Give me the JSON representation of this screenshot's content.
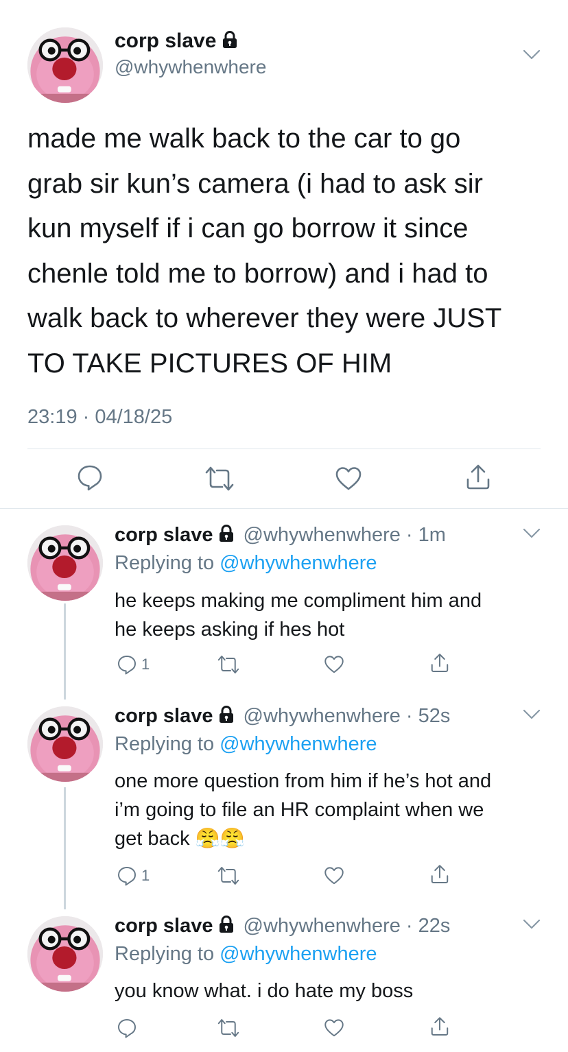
{
  "main": {
    "display_name": "corp slave",
    "handle": "@whywhenwhere",
    "text": "made me walk back to the car to go grab sir kun’s camera (i had to ask sir kun myself if i can go borrow it since chenle told me to borrow) and i had to walk back to wherever they were JUST TO TAKE PICTURES OF HIM",
    "lines": [
      "made me walk back to the car to go",
      "grab sir kun’s camera (i had to ask sir",
      "kun myself if i can go borrow it since",
      "chenle told me to borrow) and i had to",
      "walk back to wherever they were JUST",
      "TO TAKE PICTURES OF HIM"
    ],
    "timestamp": "23:19 · 04/18/25"
  },
  "replies": [
    {
      "display_name": "corp slave",
      "handle_time": "@whywhenwhere · 1m",
      "replying_prefix": "Replying to ",
      "replying_to": "@whywhenwhere",
      "lines": [
        "he keeps making me compliment him and",
        "he keeps asking if hes hot"
      ],
      "reply_count": "1"
    },
    {
      "display_name": "corp slave",
      "handle_time": "@whywhenwhere · 52s",
      "replying_prefix": "Replying to ",
      "replying_to": "@whywhenwhere",
      "lines": [
        "one more question from him if he’s hot and",
        "i’m going to file an HR complaint when we",
        "get back"
      ],
      "emoji": "😤😤",
      "reply_count": "1"
    },
    {
      "display_name": "corp slave",
      "handle_time": "@whywhenwhere · 22s",
      "replying_prefix": "Replying to ",
      "replying_to": "@whywhenwhere",
      "lines": [
        "you know what. i do hate my boss"
      ],
      "reply_count": ""
    }
  ],
  "icons": {
    "reply": "reply-icon",
    "retweet": "retweet-icon",
    "like": "heart-icon",
    "share": "share-icon",
    "lock": "lock-icon",
    "more": "chevron-down-icon"
  },
  "colors": {
    "text": "#14171a",
    "muted": "#657786",
    "link": "#1da1f2",
    "divider": "#e1e8ed"
  }
}
